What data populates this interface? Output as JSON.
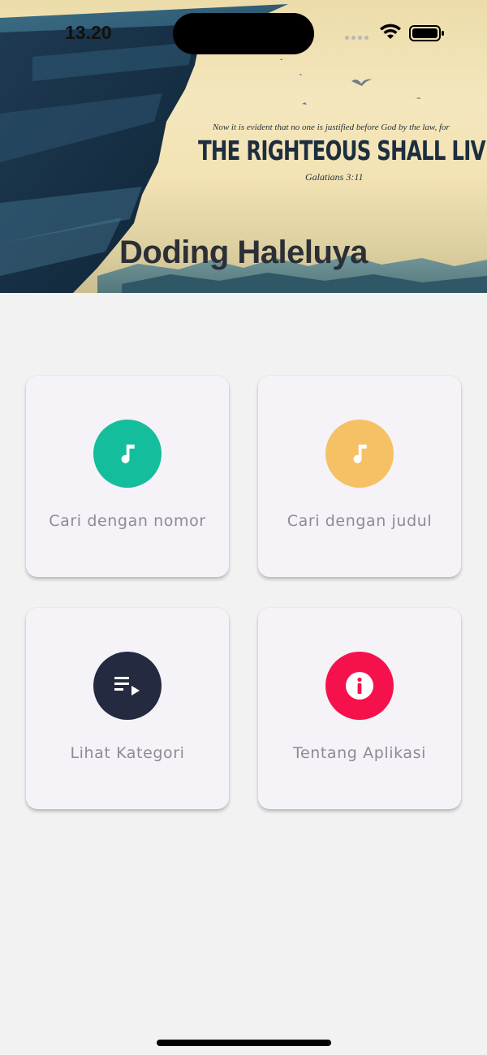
{
  "status_bar": {
    "time": "13.20"
  },
  "banner": {
    "verse_line": "Now it is evident that no one is justified before God by the law, for",
    "verse_main": "THE RIGHTEOUS SHALL LIVE BY FAITH.",
    "verse_reference": "Galatians 3:11",
    "app_title": "Doding Haleluya"
  },
  "menu": [
    {
      "label": "Cari dengan nomor",
      "icon": "music-note-icon",
      "color": "#14bd9c"
    },
    {
      "label": "Cari dengan judul",
      "icon": "music-note-icon",
      "color": "#f5c164"
    },
    {
      "label": "Lihat Kategori",
      "icon": "playlist-play-icon",
      "color": "#242a3f"
    },
    {
      "label": "Tentang Aplikasi",
      "icon": "info-icon",
      "color": "#f5124c"
    }
  ],
  "colors": {
    "background": "#f2f2f2",
    "card": "#f5f2f8",
    "title": "#2b2f36",
    "label": "#8f8b92"
  }
}
